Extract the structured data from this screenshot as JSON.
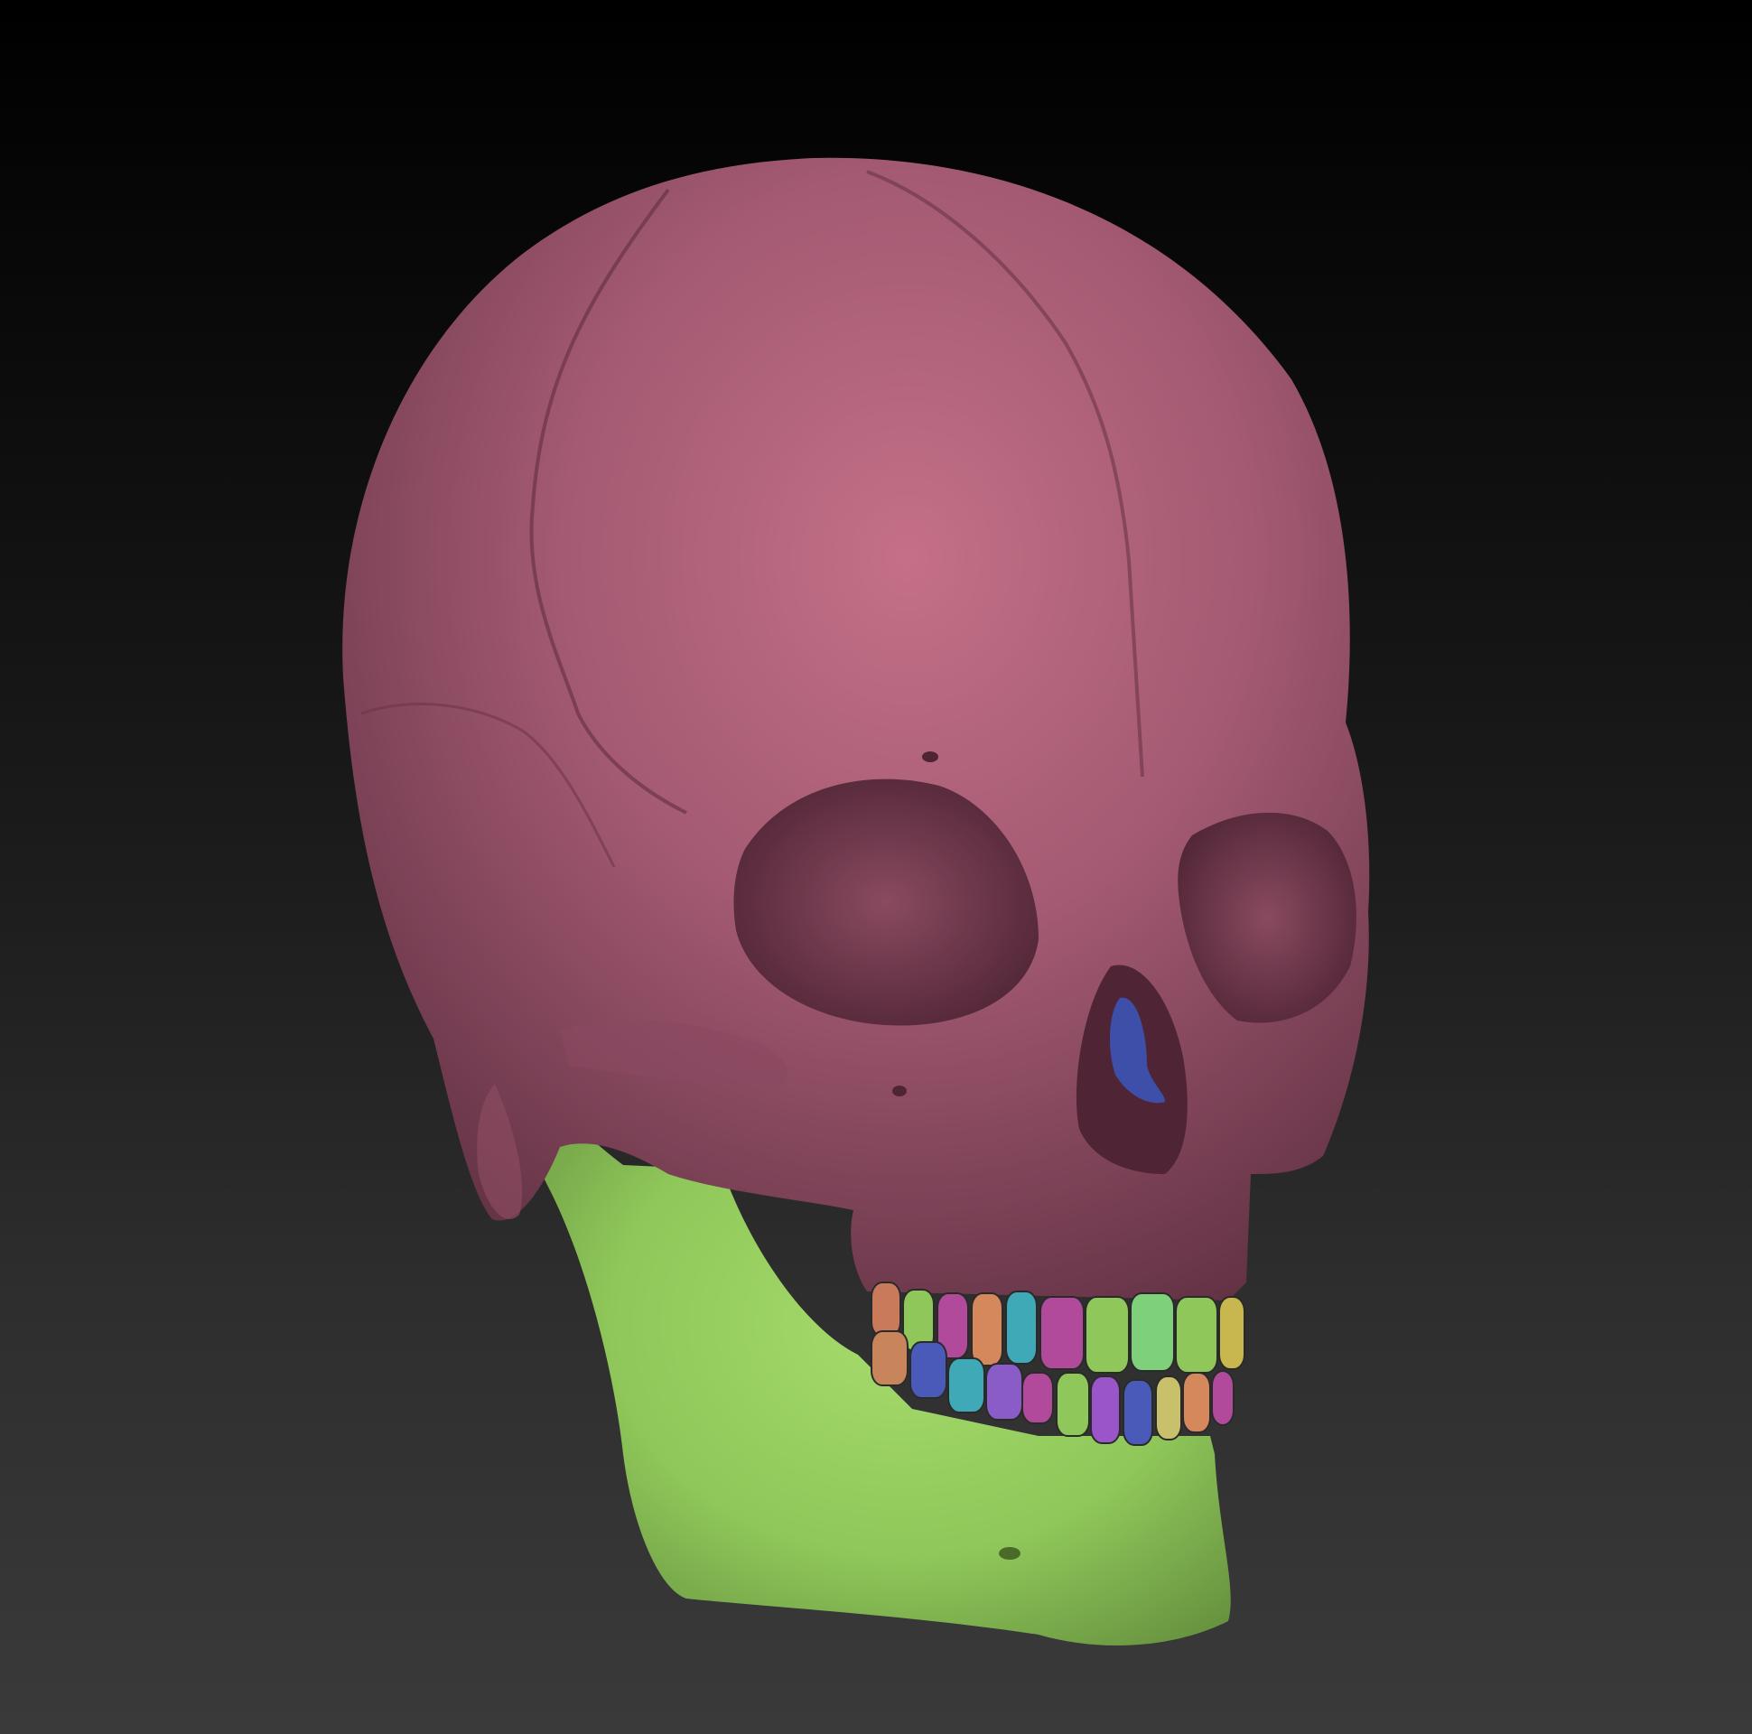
{
  "scene": {
    "background_top": "#000000",
    "background_bottom": "#3a3a3a",
    "model": {
      "polygroups": [
        {
          "name": "cranium",
          "color": "#a35a72"
        },
        {
          "name": "mandible",
          "color": "#8fc75a"
        },
        {
          "name": "nasal-concha",
          "color": "#3d4fa8"
        }
      ],
      "teeth_colors": [
        "#c87a5a",
        "#8fc75a",
        "#b14a9a",
        "#d4885c",
        "#3fa9b8",
        "#b14a9a",
        "#8fc75a",
        "#7fd07a",
        "#8fc75a",
        "#c8b64e",
        "#c8845a",
        "#4a5ab8",
        "#3fa9b8",
        "#8a5cc8",
        "#b14a9a",
        "#8fc75a",
        "#9a55c8",
        "#4a5ab8",
        "#c8c06a",
        "#d4885c",
        "#b14a9a"
      ]
    }
  }
}
